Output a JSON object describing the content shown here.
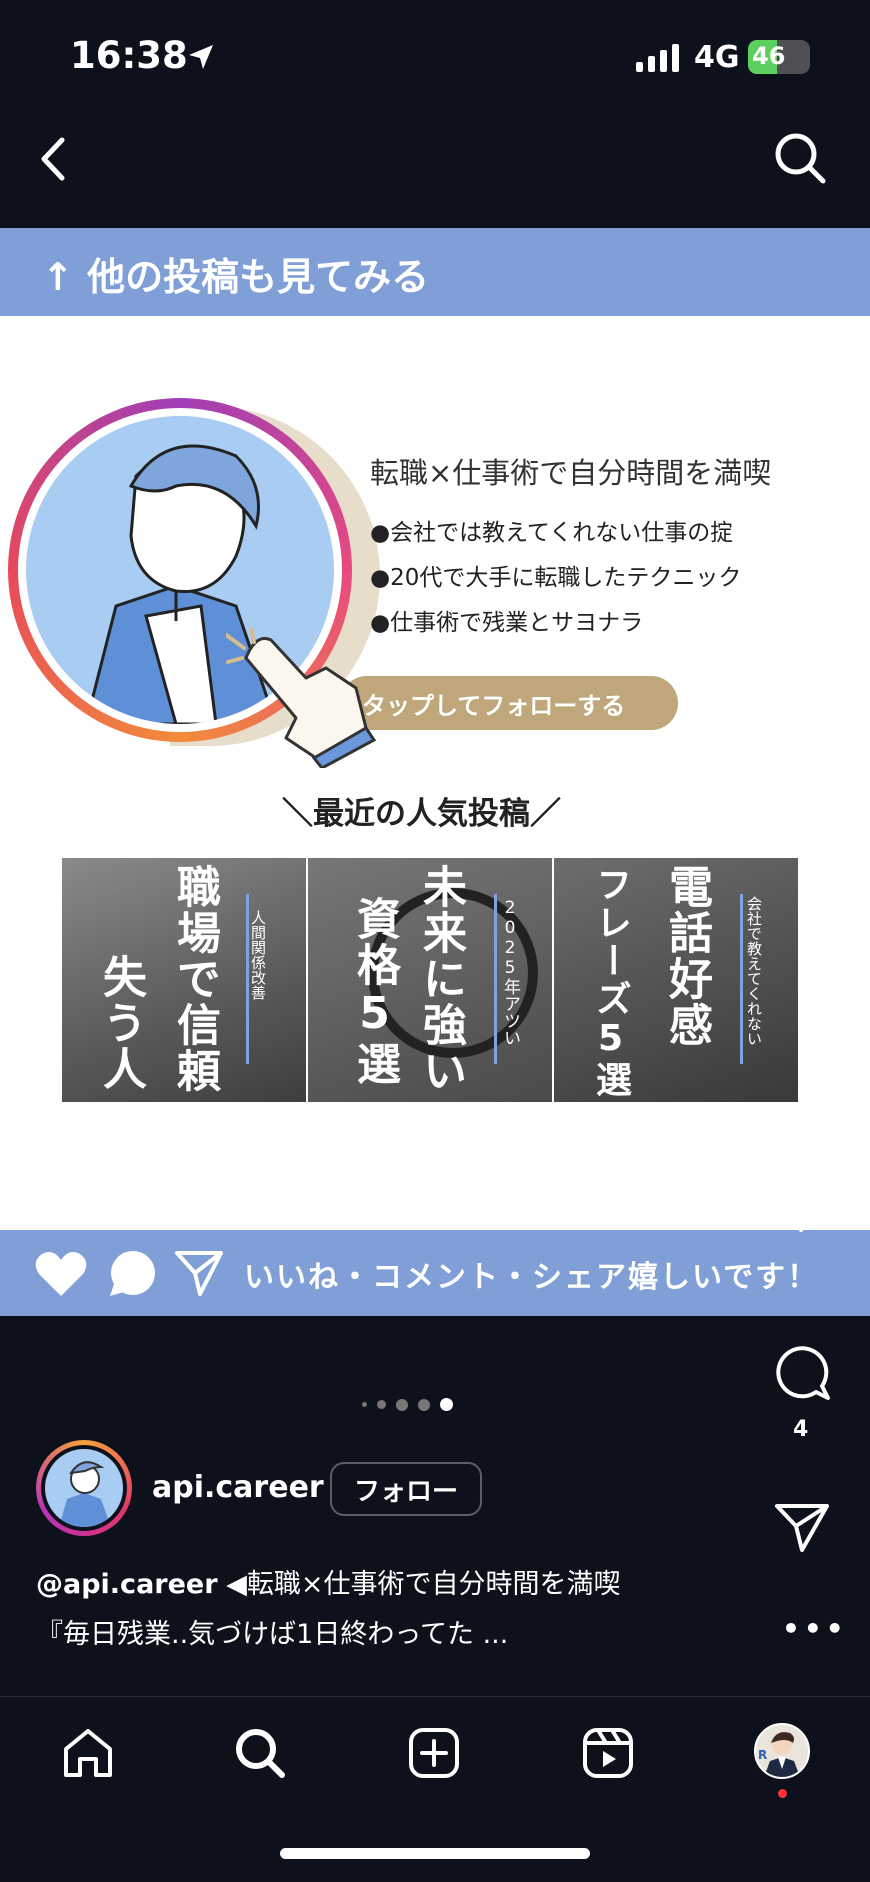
{
  "status_bar": {
    "time": "16:38",
    "network": "4G",
    "battery": "46",
    "battery_level": 0.46
  },
  "post": {
    "top_band": "↑ 他の投稿も見てみる",
    "intro_title": "転職×仕事術で自分時間を満喫",
    "bullets": [
      "●会社では教えてくれない仕事の掟",
      "●20代で大手に転職したテクニック",
      "●仕事術で残業とサヨナラ"
    ],
    "follow_pill": "タップしてフォローする",
    "popular_heading": "＼最近の人気投稿／",
    "thumbs": [
      {
        "big1": "職場で信頼",
        "big2": "失う人",
        "small": "人間関係改善"
      },
      {
        "big1": "未来に強い",
        "big2": "資格5選",
        "small": "2025年アツい"
      },
      {
        "big1": "電話好感",
        "big2": "フレーズ5選",
        "small": "会社で教えてくれない"
      }
    ],
    "bottom_band": "いいね・コメント・シェア嬉しいです！"
  },
  "actions": {
    "comment_count": "4",
    "more": "•••"
  },
  "author": {
    "username": "api.career",
    "follow_label": "フォロー"
  },
  "caption": {
    "handle": "@api.career",
    "line1_rest": " ◀︎転職×仕事術で自分時間を満喫",
    "line2": "『毎日残業..気づけば1日終わってた ..."
  },
  "icons": [
    "location-arrow-icon",
    "signal-icon",
    "back-chevron-icon",
    "search-icon",
    "heart-icon",
    "comment-icon",
    "send-icon",
    "home-icon",
    "create-icon",
    "reels-icon"
  ],
  "colors": {
    "band": "#7f9fd6",
    "bg": "#0d111b",
    "pill": "#bfa77b"
  }
}
